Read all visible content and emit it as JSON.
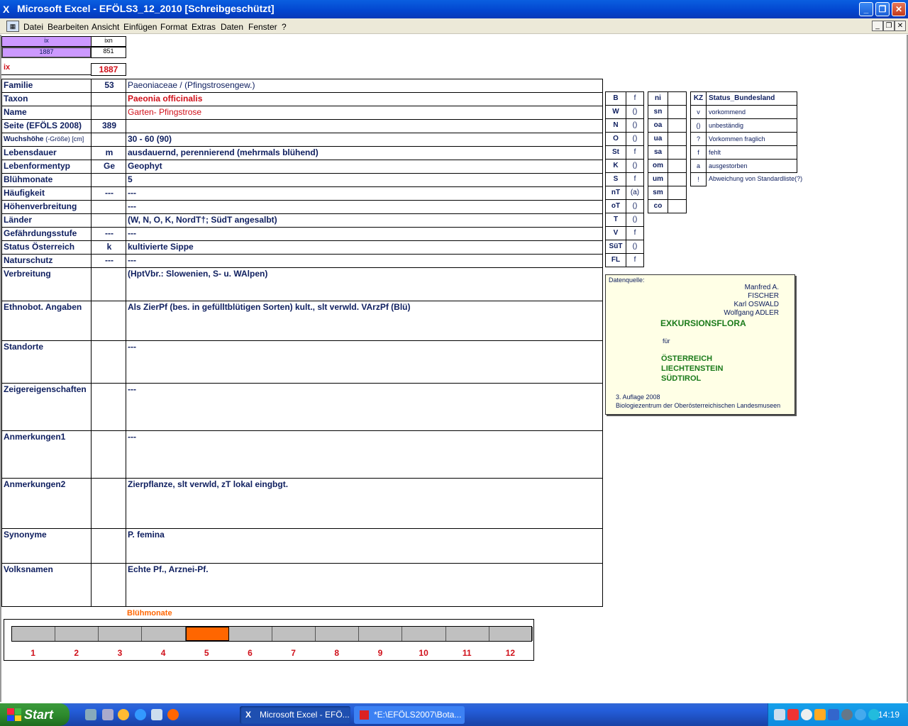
{
  "window": {
    "title": "Microsoft Excel - EFÖLS3_12_2010  [Schreibgeschützt]"
  },
  "menu": [
    "Datei",
    "Bearbeiten",
    "Ansicht",
    "Einfügen",
    "Format",
    "Extras",
    "Daten",
    "Fenster",
    "?"
  ],
  "index_box": {
    "h1": "ix",
    "h2": "ixn",
    "v1": "1887",
    "v2": "851",
    "ix_label": "ix",
    "ix_value": "1887"
  },
  "fields": [
    {
      "label": "Familie",
      "code": "53",
      "value": "Paeoniaceae  /  (Pfingstrosengew.)"
    },
    {
      "label": "Taxon",
      "code": "",
      "value": "Paeonia officinalis"
    },
    {
      "label": "Name",
      "code": "",
      "value": "Garten- Pfingstrose"
    },
    {
      "label": "Seite (EFÖLS 2008)",
      "code": "389",
      "value": ""
    },
    {
      "label": "Wuchshöhe",
      "label_suffix": "(-Größe) [cm]",
      "code": "",
      "value": " 30 - 60 (90)"
    },
    {
      "label": "Lebensdauer",
      "code": "m",
      "value": "ausdauernd, perennierend (mehrmals blühend)"
    },
    {
      "label": "Lebenformentyp",
      "code": "Ge",
      "value": "Geophyt"
    },
    {
      "label": "Blühmonate",
      "code": "",
      "value": " 5"
    },
    {
      "label": "Häufigkeit",
      "code": "---",
      "value": " ---"
    },
    {
      "label": "Höhenverbreitung",
      "code": "",
      "value": " ---"
    },
    {
      "label": "Länder",
      "code": "",
      "value": "(W, N, O, K, NordT†; SüdT angesalbt)"
    },
    {
      "label": "Gefährdungsstufe",
      "code": "---",
      "value": "   ---"
    },
    {
      "label": "Status Österreich",
      "code": "k",
      "value": "kultivierte Sippe"
    },
    {
      "label": "Naturschutz",
      "code": "---",
      "value": " ---"
    },
    {
      "label": "Verbreitung",
      "code": "",
      "value": "(HptVbr.: Slowenien, S- u. WAlpen)"
    },
    {
      "label": "Ethnobot. Angaben",
      "code": "",
      "value": "Als ZierPf (bes. in gefülltblütigen Sorten) kult., slt verwld.  VArzPf (Blü)"
    },
    {
      "label": "Standorte",
      "code": "",
      "value": "---"
    },
    {
      "label": "Zeigereigenschaften",
      "code": "",
      "value": "---"
    },
    {
      "label": "Anmerkungen1",
      "code": "",
      "value": "---"
    },
    {
      "label": "Anmerkungen2",
      "code": "",
      "value": "Zierpflanze,  slt verwld, zT lokal eingbgt."
    },
    {
      "label": "Synonyme",
      "code": "",
      "value": "P. femina"
    },
    {
      "label": "Volksnamen",
      "code": "",
      "value": "Echte Pf., Arznei-Pf."
    }
  ],
  "states": [
    {
      "k": "B",
      "v": "f"
    },
    {
      "k": "W",
      "v": "()"
    },
    {
      "k": "N",
      "v": "()"
    },
    {
      "k": "O",
      "v": "()"
    },
    {
      "k": "St",
      "v": "f"
    },
    {
      "k": "K",
      "v": "()"
    },
    {
      "k": "S",
      "v": "f"
    },
    {
      "k": "nT",
      "v": "(a)"
    },
    {
      "k": "oT",
      "v": "()"
    },
    {
      "k": "T",
      "v": "()"
    },
    {
      "k": "V",
      "v": "f"
    },
    {
      "k": "SüT",
      "v": "()"
    },
    {
      "k": "FL",
      "v": "f"
    }
  ],
  "zones": [
    "ni",
    "sn",
    "oa",
    "ua",
    "sa",
    "om",
    "um",
    "sm",
    "co"
  ],
  "legend": {
    "h1": "KZ",
    "h2": "Status_Bundesland",
    "rows": [
      {
        "k": "v",
        "v": "vorkommend"
      },
      {
        "k": "()",
        "v": "unbeständig"
      },
      {
        "k": "?",
        "v": "Vorkommen fraglich"
      },
      {
        "k": "f",
        "v": "fehlt"
      },
      {
        "k": "a",
        "v": "ausgestorben"
      },
      {
        "k": "!",
        "v": "Abweichung von Standardliste(?)"
      }
    ]
  },
  "source": {
    "label": "Datenquelle:",
    "authors": [
      "Manfred A. FISCHER",
      "Karl OSWALD",
      "Wolfgang ADLER"
    ],
    "title": "EXKURSIONSFLORA",
    "fuer": "für",
    "countries": [
      "ÖSTERREICH",
      "LIECHTENSTEIN",
      "SÜDTIROL"
    ],
    "edition": "3. Auflage 2008",
    "publisher": "Biologiezentrum der Oberösterreichischen Landesmuseen"
  },
  "bluete": {
    "title": "Blühmonate",
    "months": [
      "1",
      "2",
      "3",
      "4",
      "5",
      "6",
      "7",
      "8",
      "9",
      "10",
      "11",
      "12"
    ],
    "active": [
      5
    ],
    "active_color": "#ff6600"
  },
  "taskbar": {
    "start": "Start",
    "tasks": [
      "Microsoft Excel - EFÖ...",
      "*E:\\EFÖLS2007\\Bota..."
    ],
    "time": "14:19"
  }
}
